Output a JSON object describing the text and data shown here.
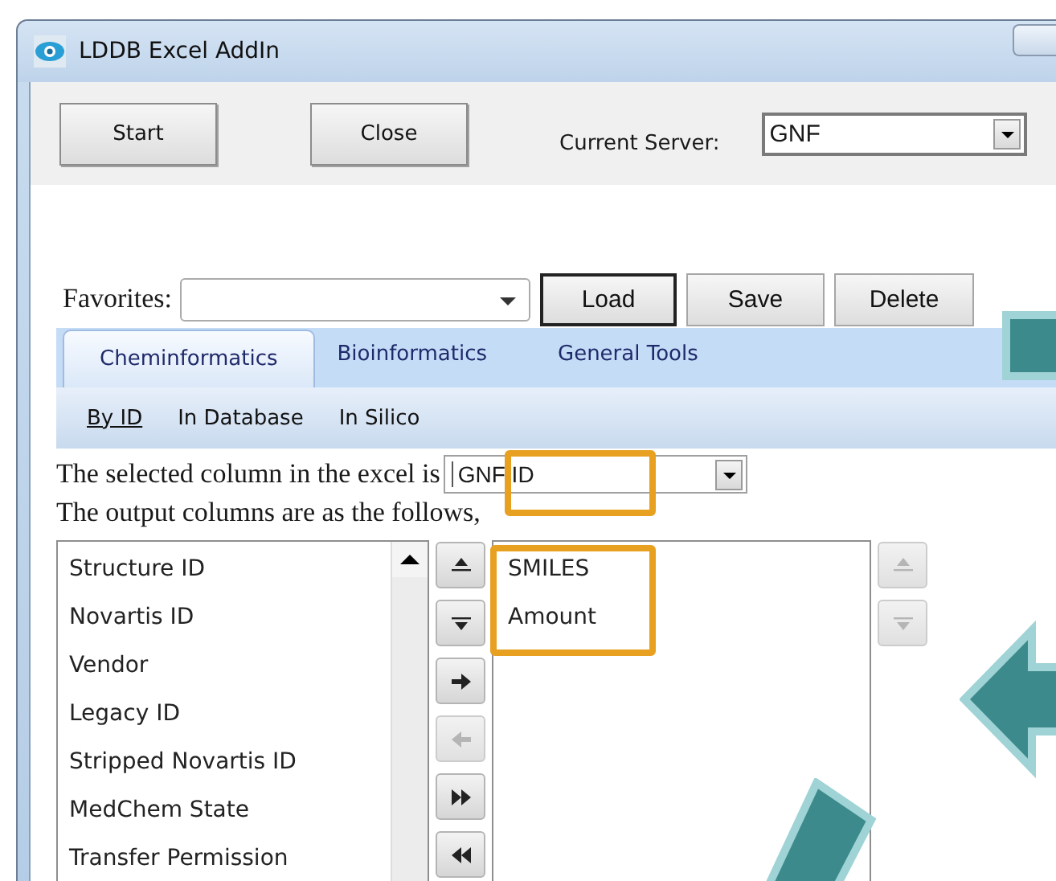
{
  "window": {
    "title": "LDDB Excel AddIn"
  },
  "top_buttons": [
    {
      "label": "Start"
    },
    {
      "label": "Close"
    }
  ],
  "server": {
    "label": "Current Server:",
    "value": "GNF"
  },
  "favorites": {
    "label": "Favorites:",
    "buttons": [
      {
        "label": "Load",
        "default": true
      },
      {
        "label": "Save",
        "default": false
      },
      {
        "label": "Delete",
        "default": false
      }
    ]
  },
  "tabs": [
    {
      "label": "Cheminformatics",
      "selected": true
    },
    {
      "label": "Bioinformatics",
      "selected": false
    },
    {
      "label": "General Tools",
      "selected": false
    }
  ],
  "subtabs": [
    {
      "label": "By ID",
      "selected": true
    },
    {
      "label": "In Database",
      "selected": false
    },
    {
      "label": "In Silico",
      "selected": false
    }
  ],
  "selected_column": {
    "label": "The selected column in the excel is",
    "value": "GNF ID"
  },
  "output_label": "The output columns are as the follows,",
  "available_columns": [
    "Structure ID",
    "Novartis ID",
    "Vendor",
    "Legacy ID",
    "Stripped Novartis ID",
    "MedChem State",
    "Transfer Permission"
  ],
  "move_buttons": [
    {
      "kind": "move-up",
      "disabled": false
    },
    {
      "kind": "move-down",
      "disabled": false
    },
    {
      "kind": "add",
      "disabled": false
    },
    {
      "kind": "remove",
      "disabled": true
    },
    {
      "kind": "add-all",
      "disabled": false
    },
    {
      "kind": "remove-all",
      "disabled": false
    }
  ],
  "output_columns": [
    "SMILES",
    "Amount"
  ],
  "order_buttons": [
    {
      "kind": "move-up",
      "disabled": true
    },
    {
      "kind": "move-down",
      "disabled": true
    }
  ]
}
